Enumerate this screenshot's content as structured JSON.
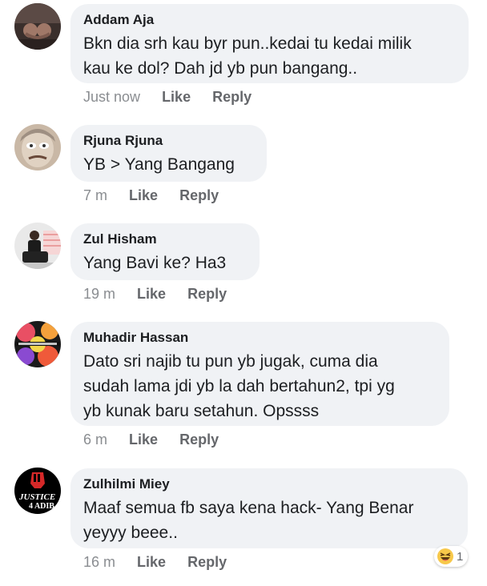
{
  "comments": [
    {
      "author": "Addam Aja",
      "lines": [
        "Bkn dia srh kau byr pun..kedai tu kedai milik",
        "kau ke dol? Dah jd yb pun bangang.."
      ],
      "time": "Just now",
      "like": "Like",
      "reply": "Reply",
      "avatar_color": "#3a2f2c"
    },
    {
      "author": "Rjuna Rjuna",
      "lines": [
        "YB > Yang Bangang"
      ],
      "time": "7 m",
      "like": "Like",
      "reply": "Reply",
      "avatar_color": "#c9b8a6"
    },
    {
      "author": "Zul Hisham",
      "lines": [
        "Yang Bavi  ke? Ha3"
      ],
      "time": "19 m",
      "like": "Like",
      "reply": "Reply",
      "avatar_color": "#e9e9e9"
    },
    {
      "author": "Muhadir Hassan",
      "lines": [
        "Dato sri najib tu pun yb jugak, cuma dia",
        "sudah lama jdi yb la dah bertahun2, tpi yg",
        "yb kunak baru setahun. Opssss"
      ],
      "time": "6 m",
      "like": "Like",
      "reply": "Reply",
      "avatar_color": "#1a1a1a"
    },
    {
      "author": "Zulhilmi Miey",
      "lines": [
        "Maaf semua fb saya kena hack- Yang Benar",
        "yeyyy beee.."
      ],
      "time": "16 m",
      "like": "Like",
      "reply": "Reply",
      "avatar_color": "#000000",
      "avatar_text": [
        "JUSTICE",
        "4 ADIB"
      ],
      "reaction": {
        "icon": "laughing-emoji-icon",
        "count": "1"
      }
    }
  ],
  "colors": {
    "bubble": "#f0f2f5",
    "text": "#1c1e21",
    "meta": "#65676b",
    "reaction_yellow": "#f7c84a",
    "accent_red": "#d62828"
  }
}
